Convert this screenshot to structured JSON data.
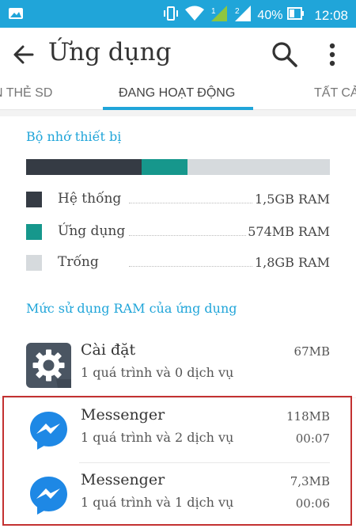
{
  "status_bar": {
    "battery_percent": "40%",
    "time": "12:08",
    "sim_labels": [
      "1",
      "2"
    ],
    "icons": [
      "image-icon",
      "vibrate-icon",
      "wifi-icon",
      "signal-icon",
      "signal-icon",
      "battery-icon"
    ]
  },
  "app_bar": {
    "title": "Ứng dụng"
  },
  "tabs": [
    {
      "label": "N THẺ SD",
      "active": false
    },
    {
      "label": "ĐANG HOẠT ĐỘNG",
      "active": true
    },
    {
      "label": "TẤT CẢ",
      "active": false
    }
  ],
  "memory": {
    "title": "Bộ nhớ thiết bị",
    "bar": [
      {
        "name": "system",
        "fraction": 0.38,
        "color": "#353b44"
      },
      {
        "name": "apps",
        "fraction": 0.15,
        "color": "#16978c"
      },
      {
        "name": "free",
        "fraction": 0.47,
        "color": "#d6dadd"
      }
    ],
    "legend": [
      {
        "label": "Hệ thống",
        "value": "1,5GB RAM",
        "color": "#353b44"
      },
      {
        "label": "Ứng dụng",
        "value": "574MB RAM",
        "color": "#16978c"
      },
      {
        "label": "Trống",
        "value": "1,8GB RAM",
        "color": "#d6dadd"
      }
    ]
  },
  "usage": {
    "title": "Mức sử dụng RAM của ứng dụng",
    "apps": [
      {
        "name": "Cài đặt",
        "subtitle": "1 quá trình và 0 dịch vụ",
        "size": "67MB",
        "time": "",
        "icon": "settings-gear-icon"
      },
      {
        "name": "Messenger",
        "subtitle": "1 quá trình và 2 dịch vụ",
        "size": "118MB",
        "time": "00:07",
        "icon": "messenger-icon"
      },
      {
        "name": "Messenger",
        "subtitle": "1 quá trình và 1 dịch vụ",
        "size": "7,3MB",
        "time": "00:06",
        "icon": "messenger-icon"
      }
    ]
  },
  "colors": {
    "accent": "#20a5d9",
    "highlight": "#c33131"
  }
}
